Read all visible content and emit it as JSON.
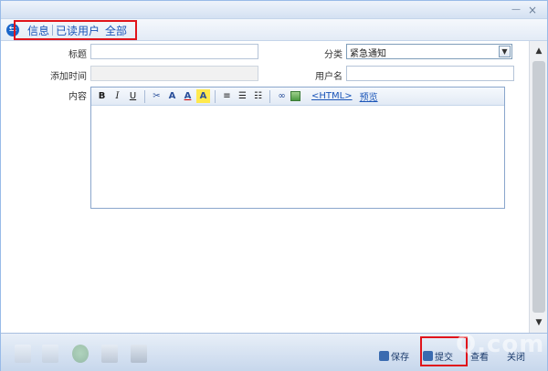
{
  "breadcrumb": [
    "信息",
    "已读用户",
    "全部"
  ],
  "form": {
    "title_label": "标题",
    "title_value": "",
    "category_label": "分类",
    "category_value": "紧急通知",
    "added_time_label": "添加时间",
    "added_time_value": "",
    "username_label": "用户名",
    "username_value": "",
    "content_label": "内容"
  },
  "editor": {
    "bold": "B",
    "italic": "I",
    "underline": "U",
    "html_link": "<HTML>",
    "preview_link": "预览"
  },
  "bottom": {
    "save": "保存",
    "submit": "提交",
    "view": "查看",
    "close": "关闭"
  },
  "watermark": "Q.com",
  "colors": {
    "accent": "#1b55b8",
    "highlight": "#e0141b"
  }
}
